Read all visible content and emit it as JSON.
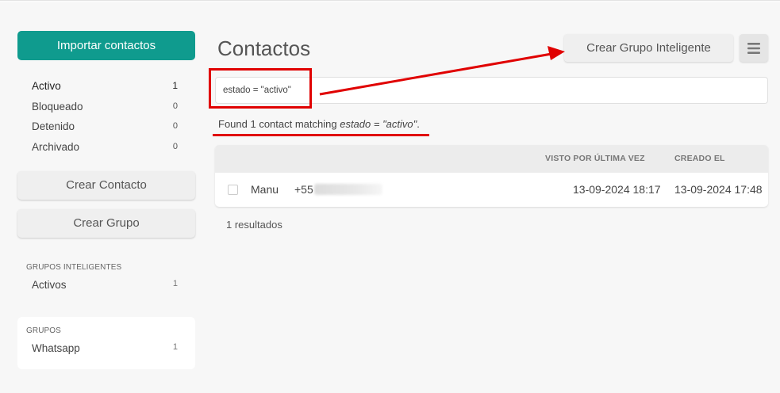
{
  "sidebar": {
    "import_label": "Importar contactos",
    "statuses": [
      {
        "label": "Activo",
        "count": "1"
      },
      {
        "label": "Bloqueado",
        "count": "0"
      },
      {
        "label": "Detenido",
        "count": "0"
      },
      {
        "label": "Archivado",
        "count": "0"
      }
    ],
    "create_contact_label": "Crear Contacto",
    "create_group_label": "Crear Grupo",
    "smart_groups": {
      "title": "GRUPOS INTELIGENTES",
      "items": [
        {
          "label": "Activos",
          "count": "1"
        }
      ]
    },
    "groups": {
      "title": "GRUPOS",
      "items": [
        {
          "label": "Whatsapp",
          "count": "1"
        }
      ]
    }
  },
  "main": {
    "title": "Contactos",
    "smart_group_button": "Crear Grupo Inteligente",
    "menu_icon": "hamburger-icon",
    "search_value": "estado = \"activo\"",
    "found": {
      "prefix": "Found 1 contact matching",
      "query": "estado = \"activo\"",
      "suffix": "."
    },
    "table": {
      "headers": {
        "seen": "VISTO POR ÚLTIMA VEZ",
        "created": "CREADO EL"
      },
      "rows": [
        {
          "name": "Manu",
          "phone": "+55",
          "seen": "13-09-2024 18:17",
          "created": "13-09-2024 17:48"
        }
      ]
    },
    "results_label": "1 resultados"
  },
  "colors": {
    "primary": "#0f9b8e",
    "annotation": "#e00000"
  }
}
